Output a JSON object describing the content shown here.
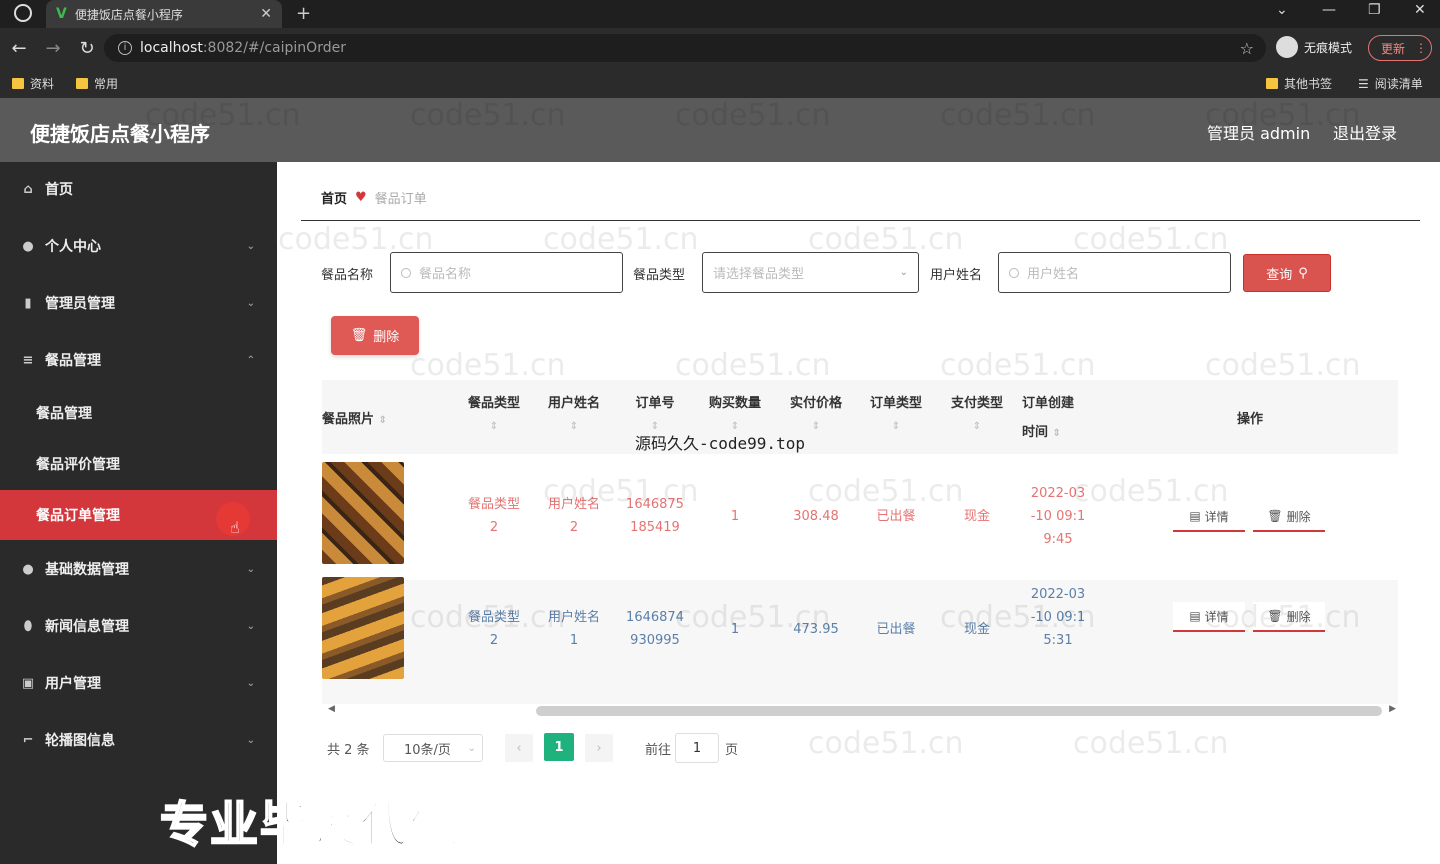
{
  "browser": {
    "tab_title": "便捷饭店点餐小程序",
    "url_host": "localhost",
    "url_path": ":8082/#/caipinOrder",
    "incognito_label": "无痕模式",
    "update_label": "更新",
    "bookmarks": [
      "资料",
      "常用"
    ],
    "other_bookmarks": "其他书签",
    "reading_list": "阅读清单"
  },
  "header": {
    "title": "便捷饭店点餐小程序",
    "user": "管理员 admin",
    "logout": "退出登录"
  },
  "sidebar": {
    "items": [
      {
        "label": "首页",
        "icon": "home-icon"
      },
      {
        "label": "个人中心",
        "icon": "user-icon"
      },
      {
        "label": "管理员管理",
        "icon": "bar-chart-icon"
      },
      {
        "label": "餐品管理",
        "icon": "menu-icon"
      },
      {
        "label": "基础数据管理",
        "icon": "user-icon"
      },
      {
        "label": "新闻信息管理",
        "icon": "location-icon"
      },
      {
        "label": "用户管理",
        "icon": "calendar-icon"
      },
      {
        "label": "轮播图信息",
        "icon": "crop-icon"
      }
    ],
    "submenu": [
      "餐品管理",
      "餐品评价管理",
      "餐品订单管理"
    ],
    "active": "餐品订单管理",
    "active_color": "#d3363b"
  },
  "breadcrumb": {
    "home": "首页",
    "current": "餐品订单"
  },
  "search": {
    "name_label": "餐品名称",
    "name_placeholder": "餐品名称",
    "type_label": "餐品类型",
    "type_placeholder": "请选择餐品类型",
    "user_label": "用户姓名",
    "user_placeholder": "用户姓名",
    "query_button": "查询"
  },
  "toolbar": {
    "delete_button": "删除"
  },
  "table": {
    "headers": [
      "餐品照片",
      "餐品类型",
      "用户姓名",
      "订单号",
      "购买数量",
      "实付价格",
      "订单类型",
      "支付类型",
      "订单创建",
      "时间",
      "操作"
    ],
    "rows": [
      {
        "type_1": "餐品类型",
        "type_2": "2",
        "user_1": "用户姓名",
        "user_2": "2",
        "order_1": "1646875",
        "order_2": "185419",
        "qty": "1",
        "price": "308.48",
        "order_type": "已出餐",
        "pay_type": "现金",
        "time_1": "2022-03",
        "time_2": "-10 09:1",
        "time_3": "9:45"
      },
      {
        "type_1": "餐品类型",
        "type_2": "2",
        "user_1": "用户姓名",
        "user_2": "1",
        "order_1": "1646874",
        "order_2": "930995",
        "qty": "1",
        "price": "473.95",
        "order_type": "已出餐",
        "pay_type": "现金",
        "time_1": "2022-03",
        "time_2": "-10 09:1",
        "time_3": "5:31"
      }
    ],
    "detail_button": "详情",
    "delete_button": "删除"
  },
  "pagination": {
    "total": "共 2 条",
    "page_size": "10条/页",
    "current_page": "1",
    "goto_label": "前往",
    "goto_value": "1",
    "page_unit": "页"
  },
  "overlay": {
    "source_text": "源码久久-code99.top",
    "banner": "专业毕设代做",
    "watermark": "code51.cn"
  }
}
